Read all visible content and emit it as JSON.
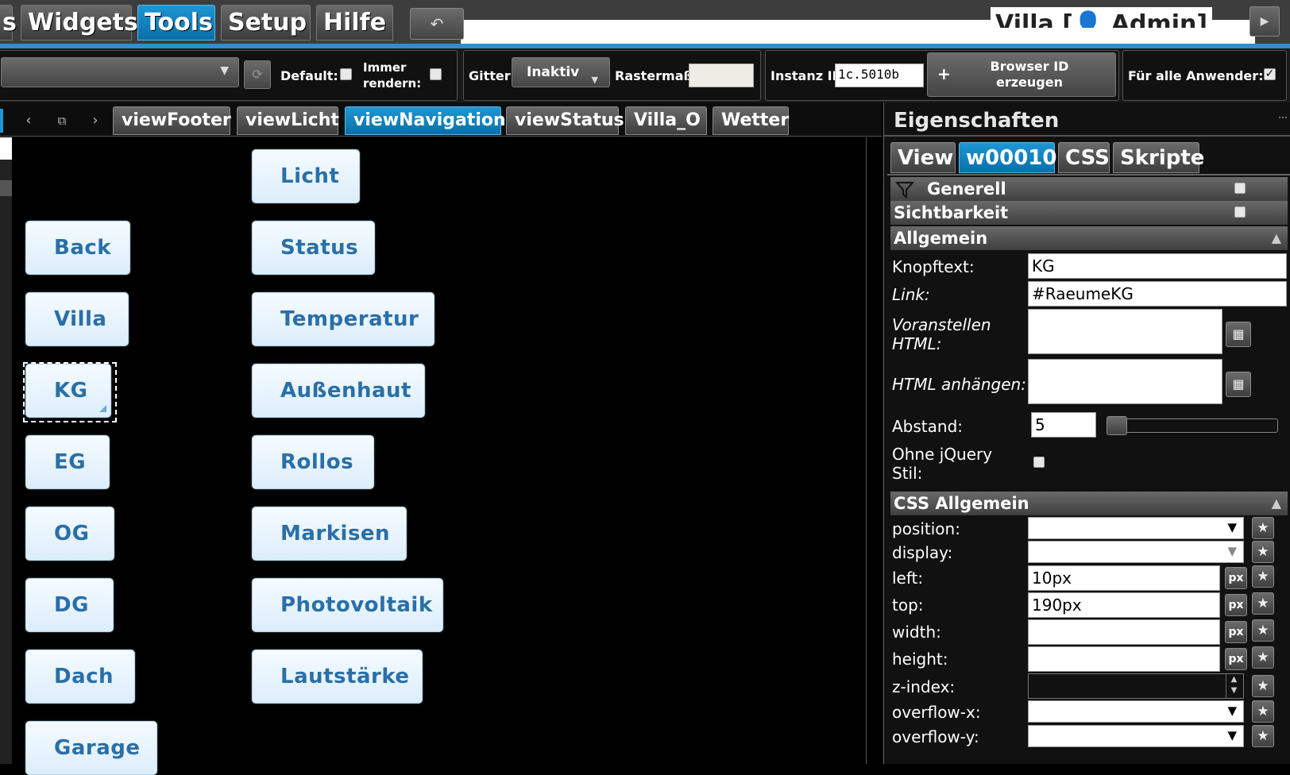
{
  "menu": {
    "tabs": [
      {
        "label": "s"
      },
      {
        "label": "Widgets"
      },
      {
        "label": "Tools"
      },
      {
        "label": "Setup"
      },
      {
        "label": "Hilfe"
      }
    ],
    "undo_icon": "↶",
    "app_title": "Villa [👤 Admin]",
    "play_icon": "▶"
  },
  "toolbar": {
    "default_label": "Default:",
    "render_label_1": "Immer",
    "render_label_2": "rendern:",
    "grid_label": "Gitter",
    "grid_value": "Inaktiv",
    "raster_label": "Rastermaß:",
    "raster_value": "",
    "instance_label": "Instanz ID",
    "instance_value": "1c.5010b",
    "browser_id_line1": "Browser ID",
    "browser_id_line2": "erzeugen",
    "all_users_label": "Für alle Anwender:",
    "all_users_checked": "✓",
    "refresh_icon": "⟳",
    "plus_icon": "+"
  },
  "view_tabs": [
    {
      "label": "viewFooter"
    },
    {
      "label": "viewLicht"
    },
    {
      "label": "viewNavigation"
    },
    {
      "label": "viewStatus"
    },
    {
      "label": "Villa_O"
    },
    {
      "label": "Wetter"
    }
  ],
  "nav_icons": {
    "prev": "‹",
    "copy": "⧉",
    "next": "›"
  },
  "canvas": {
    "left_buttons": [
      {
        "label": "Back"
      },
      {
        "label": "Villa"
      },
      {
        "label": "KG"
      },
      {
        "label": "EG"
      },
      {
        "label": "OG"
      },
      {
        "label": "DG"
      },
      {
        "label": "Dach"
      },
      {
        "label": "Garage"
      }
    ],
    "right_buttons": [
      {
        "label": "Licht"
      },
      {
        "label": "Status"
      },
      {
        "label": "Temperatur"
      },
      {
        "label": "Außenhaut"
      },
      {
        "label": "Rollos"
      },
      {
        "label": "Markisen"
      },
      {
        "label": "Photovoltaik"
      },
      {
        "label": "Lautstärke"
      }
    ]
  },
  "properties": {
    "title": "Eigenschaften",
    "tabs": [
      {
        "label": "View"
      },
      {
        "label": "w00010"
      },
      {
        "label": "CSS"
      },
      {
        "label": "Skripte"
      }
    ],
    "sections": {
      "generell": "Generell",
      "sichtbarkeit": "Sichtbarkeit",
      "allgemein": "Allgemein",
      "css_allgemein": "CSS Allgemein"
    },
    "fields": {
      "knopftext_label": "Knopftext:",
      "knopftext_value": "KG",
      "link_label": "Link:",
      "link_value": "#RaeumeKG",
      "prepend_label_1": "Voranstellen",
      "prepend_label_2": "HTML:",
      "append_label": "HTML anhängen:",
      "abstand_label": "Abstand:",
      "abstand_value": "5",
      "no_jquery_label_1": "Ohne jQuery",
      "no_jquery_label_2": "Stil:"
    },
    "css": {
      "position_label": "position:",
      "display_label": "display:",
      "left_label": "left:",
      "left_value": "10px",
      "top_label": "top:",
      "top_value": "190px",
      "width_label": "width:",
      "height_label": "height:",
      "zindex_label": "z-index:",
      "overflowx_label": "overflow-x:",
      "overflowy_label": "overflow-y:",
      "unit": "px"
    }
  }
}
